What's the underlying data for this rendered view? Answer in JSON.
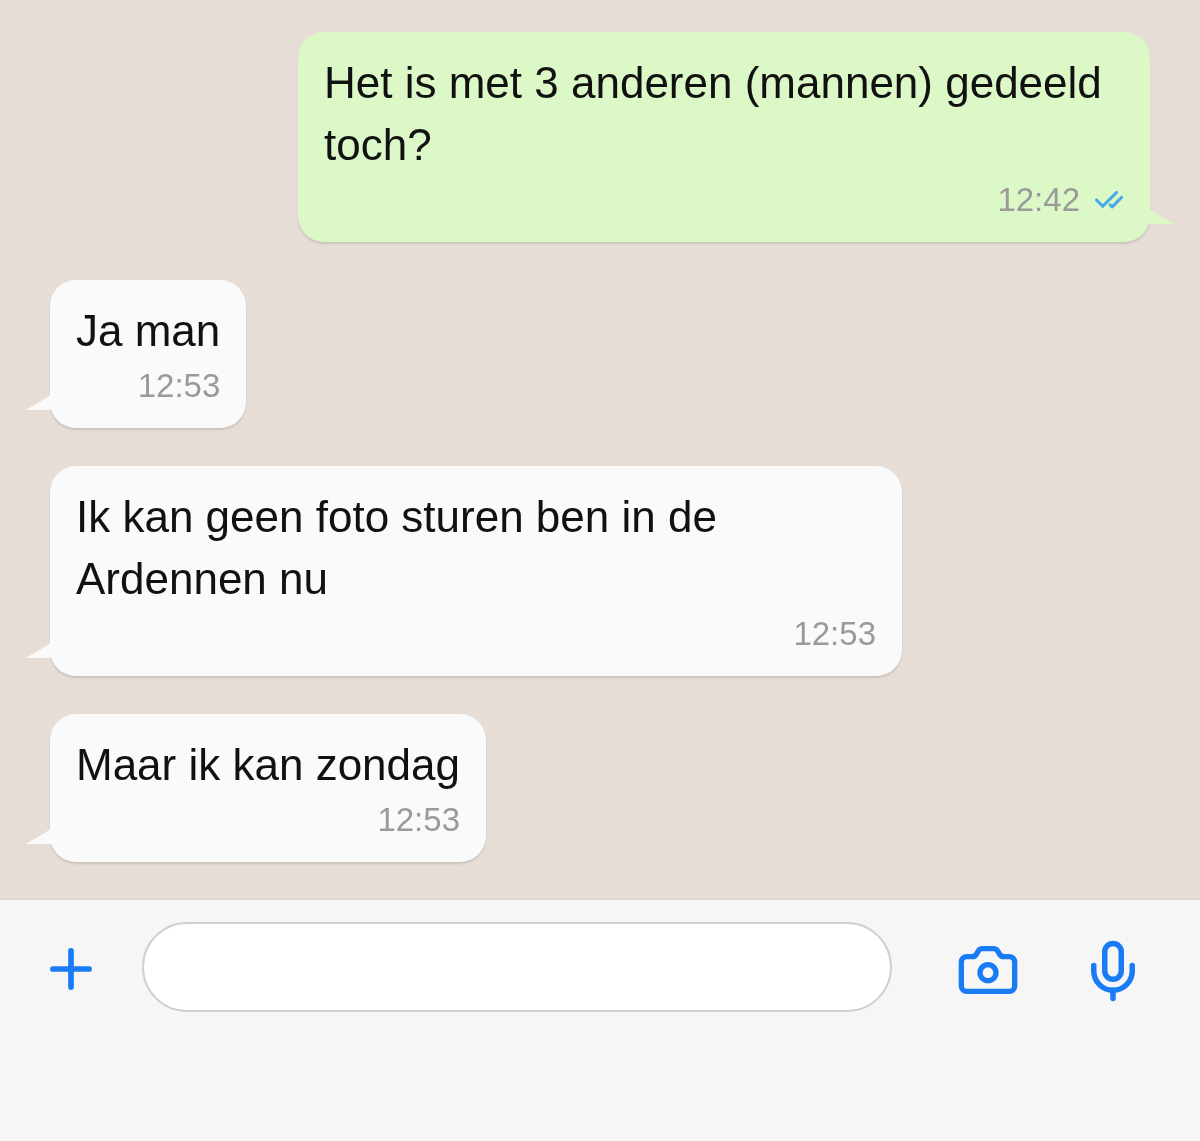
{
  "messages": [
    {
      "kind": "outgoing",
      "text": "Het is met 3 anderen (mannen) gedeeld toch?",
      "time": "12:42",
      "read": true
    },
    {
      "kind": "incoming",
      "text": "Ja man",
      "time": "12:53"
    },
    {
      "kind": "incoming",
      "text": "Ik kan geen foto sturen ben in de Ardennen nu",
      "time": "12:53"
    },
    {
      "kind": "incoming",
      "text": "Maar ik kan zondag",
      "time": "12:53"
    }
  ]
}
